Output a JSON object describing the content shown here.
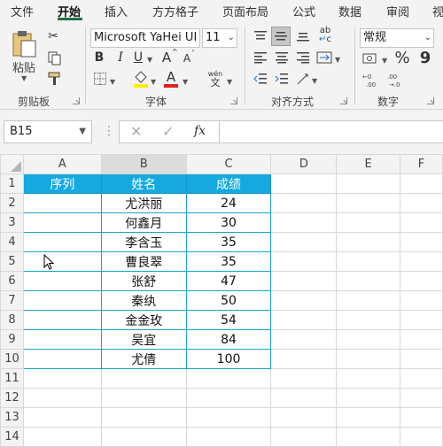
{
  "tabs": [
    {
      "label": "文件",
      "active": false
    },
    {
      "label": "开始",
      "active": true
    },
    {
      "label": "插入",
      "active": false
    },
    {
      "label": "方方格子",
      "active": false
    },
    {
      "label": "页面布局",
      "active": false
    },
    {
      "label": "公式",
      "active": false
    },
    {
      "label": "数据",
      "active": false
    },
    {
      "label": "审阅",
      "active": false
    },
    {
      "label": "视",
      "active": false
    }
  ],
  "ribbon": {
    "clipboard": {
      "label": "剪贴板",
      "paste_label": "粘贴"
    },
    "font": {
      "label": "字体",
      "font_name": "Microsoft YaHei UI",
      "font_size": "11",
      "bold": "B",
      "italic": "I",
      "underline": "U",
      "grow": "A",
      "shrink": "A",
      "font_color": "A",
      "pinyin_top": "wén",
      "pinyin_bottom": "文"
    },
    "alignment": {
      "label": "对齐方式",
      "wrap_top": "ab",
      "wrap_bottom": "c"
    },
    "number": {
      "label": "数字",
      "format": "常规",
      "percent": "%",
      "comma": "9"
    }
  },
  "formula_bar": {
    "name_box": "B15",
    "fx": "fx",
    "formula": ""
  },
  "sheet": {
    "columns": [
      "A",
      "B",
      "C",
      "D",
      "E",
      "F"
    ],
    "rows": [
      "1",
      "2",
      "3",
      "4",
      "5",
      "6",
      "7",
      "8",
      "9",
      "10",
      "11",
      "12",
      "13",
      "14"
    ],
    "header": [
      "序列",
      "姓名",
      "成绩"
    ],
    "records": [
      {
        "name": "尤洪丽",
        "score": "24"
      },
      {
        "name": "何鑫月",
        "score": "30"
      },
      {
        "name": "李含玉",
        "score": "35"
      },
      {
        "name": "曹良翠",
        "score": "35"
      },
      {
        "name": "张舒",
        "score": "47"
      },
      {
        "name": "秦纨",
        "score": "50"
      },
      {
        "name": "金金玫",
        "score": "54"
      },
      {
        "name": "吴宜",
        "score": "84"
      },
      {
        "name": "尤倩",
        "score": "100"
      }
    ]
  },
  "colors": {
    "accent": "#217346",
    "header_fill": "#15a9e0",
    "border": "#19a3c7"
  }
}
